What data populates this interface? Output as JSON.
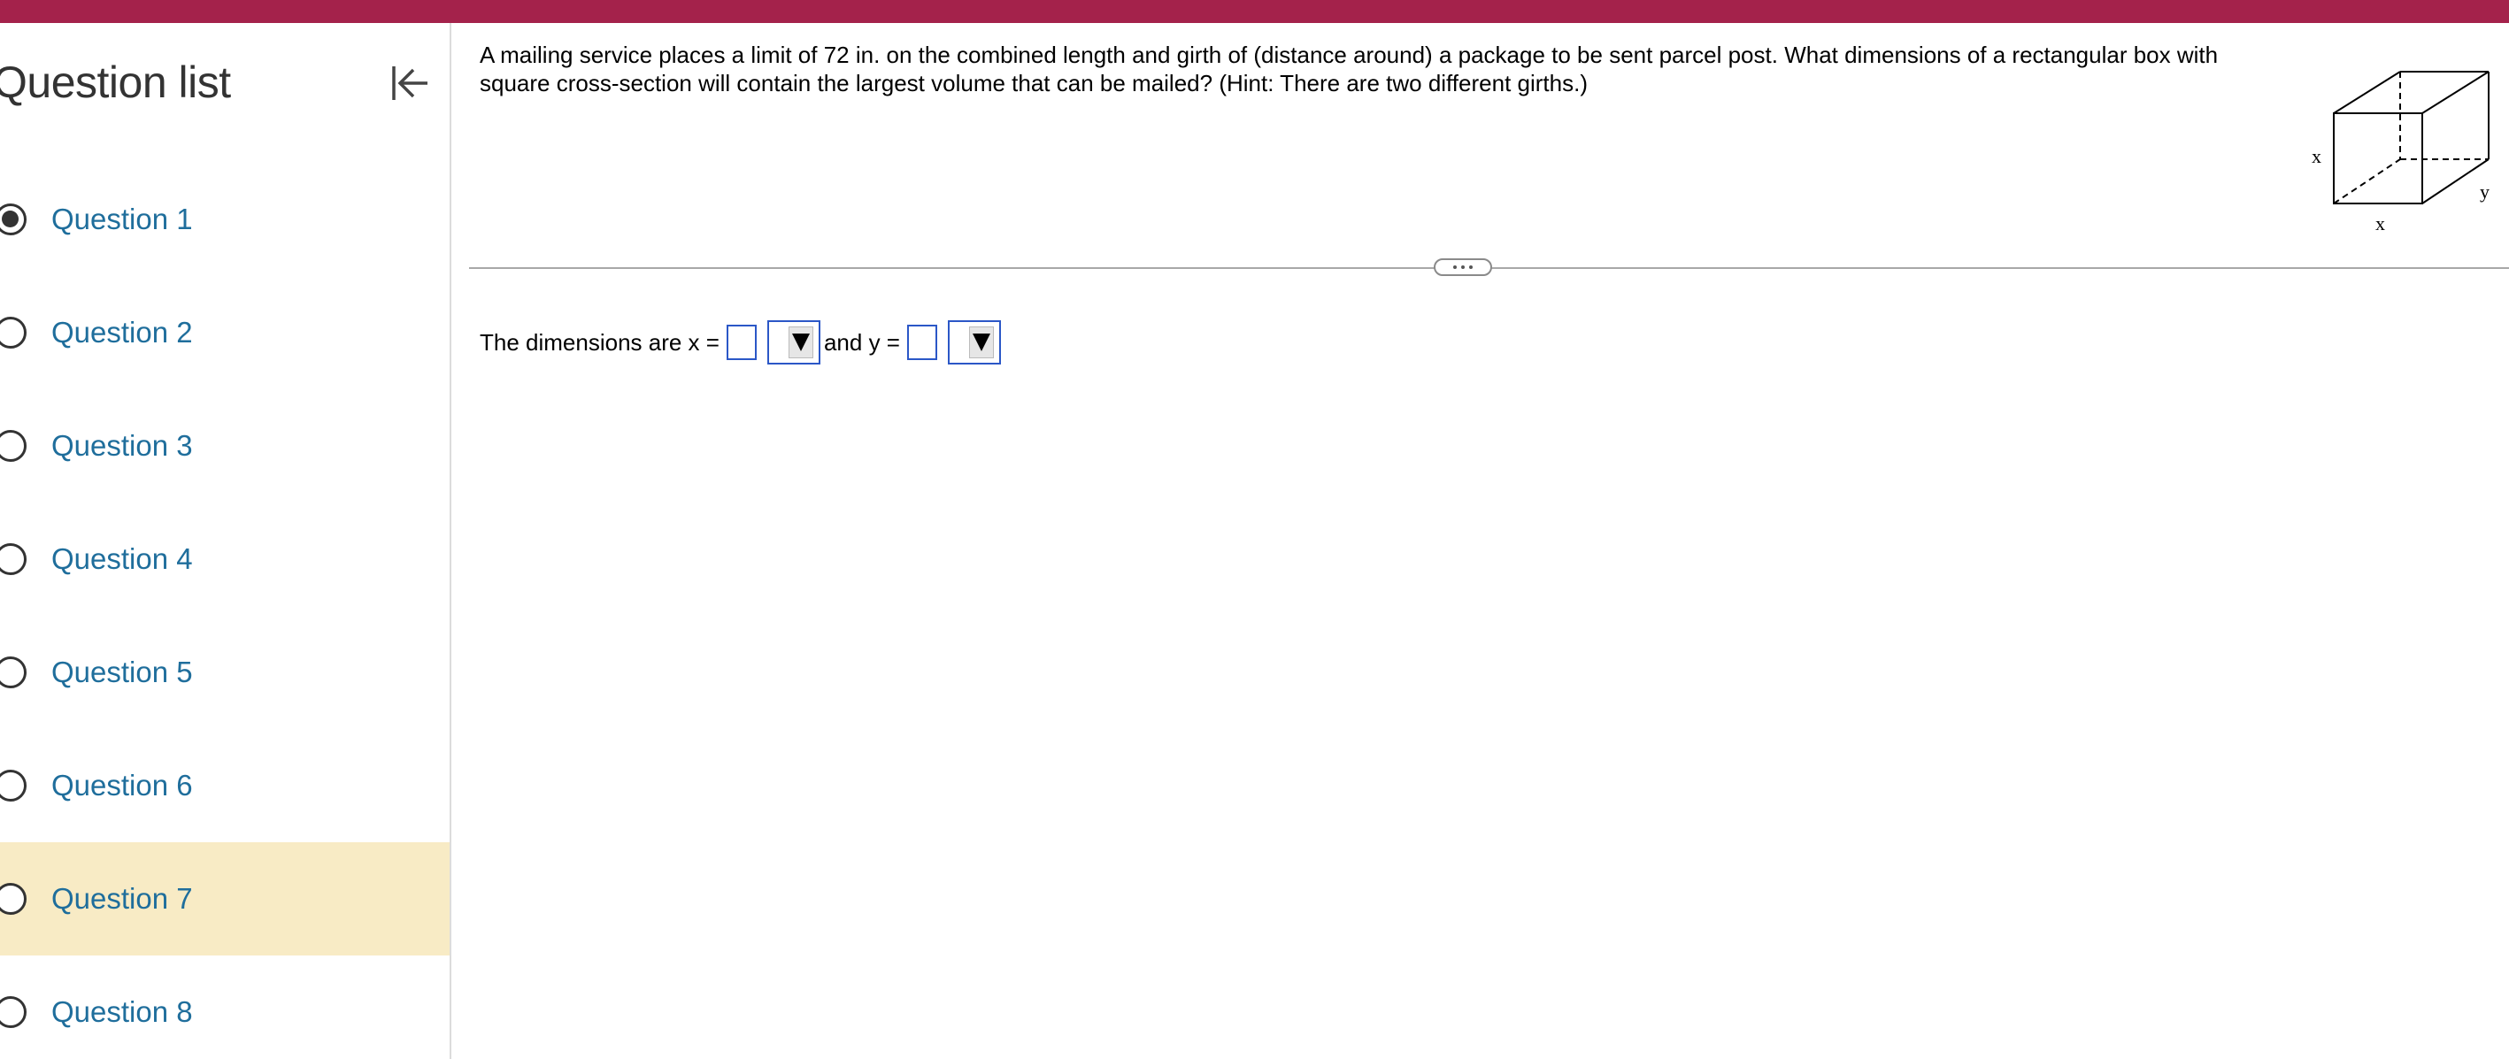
{
  "colors": {
    "topbar": "#a4224b",
    "link": "#1f6e9c",
    "highlight": "#f8ebc5",
    "input_border": "#2b57c7"
  },
  "sidebar": {
    "title": "Question list",
    "collapse_icon": "collapse-left-icon",
    "items": [
      {
        "label": "Question 1",
        "checked": true
      },
      {
        "label": "Question 2"
      },
      {
        "label": "Question 3"
      },
      {
        "label": "Question 4"
      },
      {
        "label": "Question 5"
      },
      {
        "label": "Question 6"
      },
      {
        "label": "Question 7",
        "highlighted": true
      },
      {
        "label": "Question 8"
      }
    ]
  },
  "question": {
    "text": "A mailing service places a limit of 72 in. on the combined length and girth of (distance around) a package to be sent parcel post. What dimensions of a rectangular box with square cross-section will contain the largest volume that can be mailed? (Hint: There are two different girths.)",
    "figure_labels": {
      "left": "x",
      "bottom": "x",
      "right": "y"
    }
  },
  "answer": {
    "prefix": "The dimensions are x =",
    "middle": "and y =",
    "x_value": "",
    "y_value": ""
  }
}
